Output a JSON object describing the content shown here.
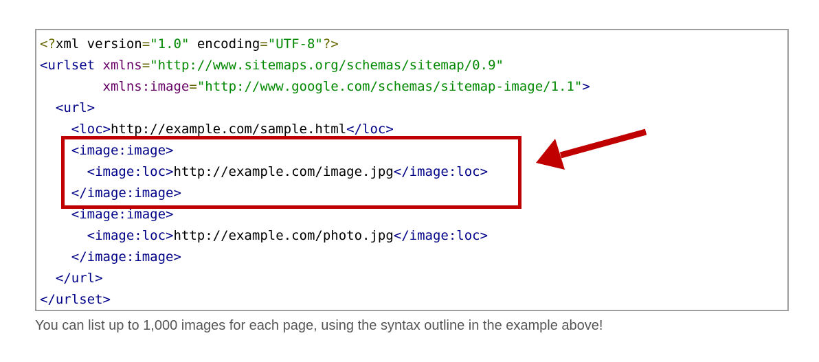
{
  "code": {
    "lines": [
      [
        {
          "cls": "pun",
          "text": "<?"
        },
        {
          "cls": "pln",
          "text": "xml version"
        },
        {
          "cls": "pun",
          "text": "="
        },
        {
          "cls": "str",
          "text": "\"1.0\""
        },
        {
          "cls": "pln",
          "text": " encoding"
        },
        {
          "cls": "pun",
          "text": "="
        },
        {
          "cls": "str",
          "text": "\"UTF-8\""
        },
        {
          "cls": "pun",
          "text": "?>"
        }
      ],
      [
        {
          "cls": "tag",
          "text": "<urlset"
        },
        {
          "cls": "pln",
          "text": " "
        },
        {
          "cls": "attr",
          "text": "xmlns"
        },
        {
          "cls": "pun",
          "text": "="
        },
        {
          "cls": "str",
          "text": "\"http://www.sitemaps.org/schemas/sitemap/0.9\""
        }
      ],
      [
        {
          "cls": "pln",
          "text": "        "
        },
        {
          "cls": "attr",
          "text": "xmlns:image"
        },
        {
          "cls": "pun",
          "text": "="
        },
        {
          "cls": "str",
          "text": "\"http://www.google.com/schemas/sitemap-image/1.1\""
        },
        {
          "cls": "tag",
          "text": ">"
        }
      ],
      [
        {
          "cls": "pln",
          "text": "  "
        },
        {
          "cls": "tag",
          "text": "<url>"
        }
      ],
      [
        {
          "cls": "pln",
          "text": "    "
        },
        {
          "cls": "tag",
          "text": "<loc>"
        },
        {
          "cls": "pln",
          "text": "http://example.com/sample.html"
        },
        {
          "cls": "tag",
          "text": "</loc>"
        }
      ],
      [
        {
          "cls": "pln",
          "text": "    "
        },
        {
          "cls": "tag",
          "text": "<image:image>"
        }
      ],
      [
        {
          "cls": "pln",
          "text": "      "
        },
        {
          "cls": "tag",
          "text": "<image:loc>"
        },
        {
          "cls": "pln",
          "text": "http://example.com/image.jpg"
        },
        {
          "cls": "tag",
          "text": "</image:loc>"
        }
      ],
      [
        {
          "cls": "pln",
          "text": "    "
        },
        {
          "cls": "tag",
          "text": "</image:image>"
        }
      ],
      [
        {
          "cls": "pln",
          "text": "    "
        },
        {
          "cls": "tag",
          "text": "<image:image>"
        }
      ],
      [
        {
          "cls": "pln",
          "text": "      "
        },
        {
          "cls": "tag",
          "text": "<image:loc>"
        },
        {
          "cls": "pln",
          "text": "http://example.com/photo.jpg"
        },
        {
          "cls": "tag",
          "text": "</image:loc>"
        }
      ],
      [
        {
          "cls": "pln",
          "text": "    "
        },
        {
          "cls": "tag",
          "text": "</image:image>"
        }
      ],
      [
        {
          "cls": "pln",
          "text": "  "
        },
        {
          "cls": "tag",
          "text": "</url>"
        }
      ],
      [
        {
          "cls": "tag",
          "text": "</urlset>"
        }
      ]
    ]
  },
  "annotation": {
    "highlight_color": "#c00000",
    "arrow_icon": "arrow-left-icon"
  },
  "caption": "You can list up to 1,000 images for each page, using the syntax outline in the example above!"
}
